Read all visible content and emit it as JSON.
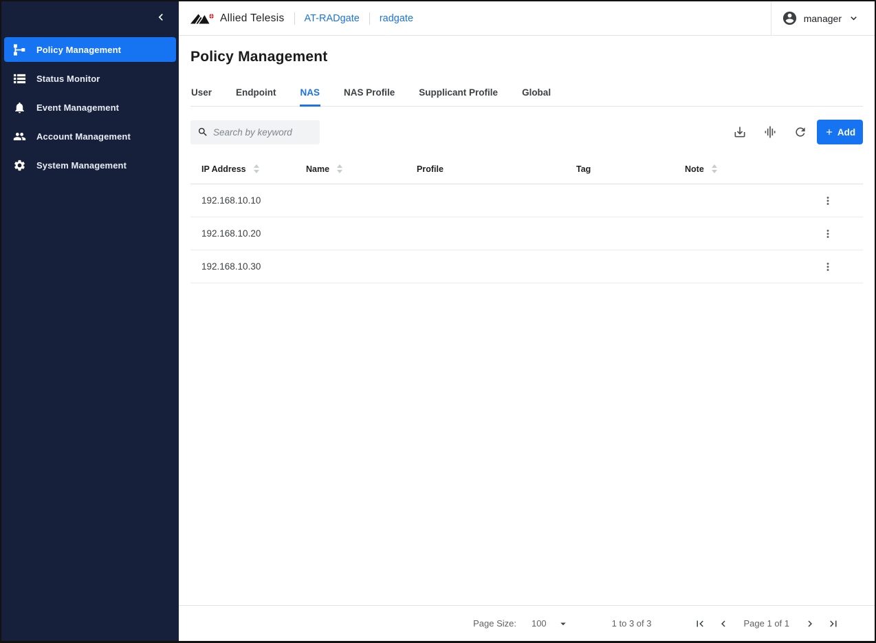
{
  "colors": {
    "accent_blue": "#1673F2",
    "link_blue": "#1A73E8",
    "sidebar_bg": "#16203A",
    "brand_red": "#E3242B"
  },
  "sidebar": {
    "collapse_icon": "chevron-left-icon",
    "items": [
      {
        "label": "Policy Management",
        "icon": "policy-tree-icon",
        "active": true
      },
      {
        "label": "Status Monitor",
        "icon": "list-icon",
        "active": false
      },
      {
        "label": "Event Management",
        "icon": "bell-icon",
        "active": false
      },
      {
        "label": "Account Management",
        "icon": "people-icon",
        "active": false
      },
      {
        "label": "System Management",
        "icon": "gear-icon",
        "active": false
      }
    ]
  },
  "topbar": {
    "brand": "Allied Telesis",
    "breadcrumbs": [
      "AT-RADgate",
      "radgate"
    ],
    "user": {
      "name": "manager",
      "icon": "account-circle-icon"
    }
  },
  "page": {
    "title": "Policy Management",
    "tabs": [
      {
        "label": "User",
        "active": false
      },
      {
        "label": "Endpoint",
        "active": false
      },
      {
        "label": "NAS",
        "active": true
      },
      {
        "label": "NAS Profile",
        "active": false
      },
      {
        "label": "Supplicant Profile",
        "active": false
      },
      {
        "label": "Global",
        "active": false
      }
    ]
  },
  "toolbar": {
    "search_placeholder": "Search by keyword",
    "icons": [
      "download-icon",
      "graphic-eq-icon",
      "refresh-icon"
    ],
    "add_label": "Add"
  },
  "table": {
    "columns": [
      {
        "label": "IP Address",
        "sortable": true
      },
      {
        "label": "Name",
        "sortable": true
      },
      {
        "label": "Profile",
        "sortable": false
      },
      {
        "label": "Tag",
        "sortable": false
      },
      {
        "label": "Note",
        "sortable": true
      }
    ],
    "rows": [
      {
        "ip_address": "192.168.10.10",
        "name": "",
        "profile": "",
        "tag": "",
        "note": ""
      },
      {
        "ip_address": "192.168.10.20",
        "name": "",
        "profile": "",
        "tag": "",
        "note": ""
      },
      {
        "ip_address": "192.168.10.30",
        "name": "",
        "profile": "",
        "tag": "",
        "note": ""
      }
    ]
  },
  "pagination": {
    "page_size_label": "Page Size:",
    "page_size_value": "100",
    "range_text": "1 to 3 of 3",
    "page_text": "Page 1 of 1"
  }
}
